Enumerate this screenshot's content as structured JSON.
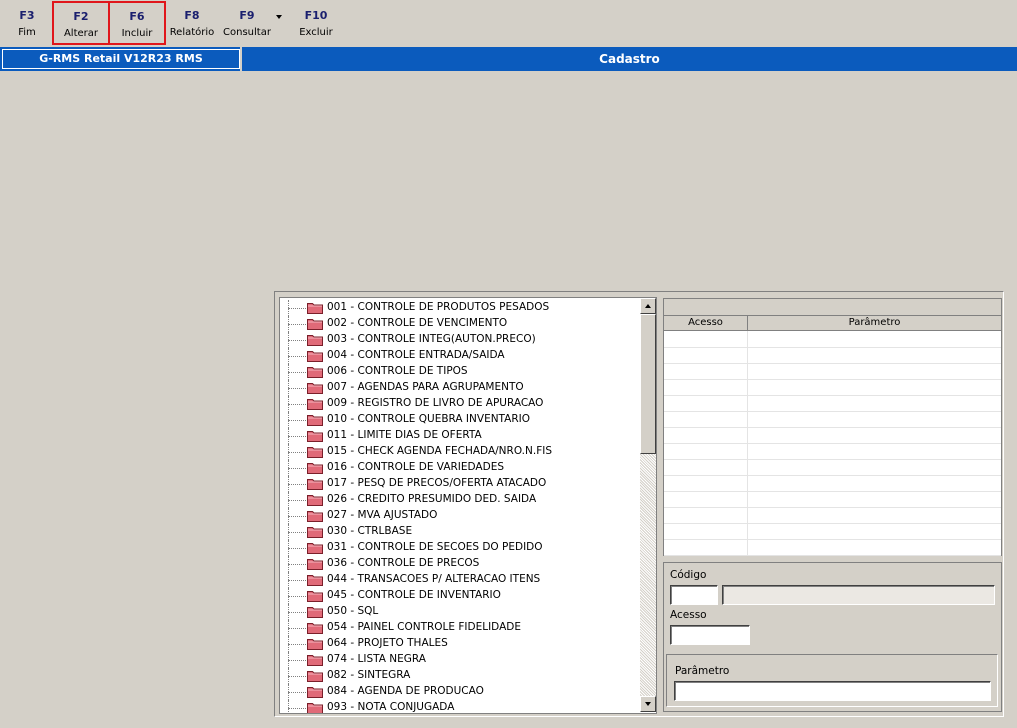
{
  "toolbar": {
    "buttons": [
      {
        "key": "F3",
        "label": "Fim"
      },
      {
        "key": "F2",
        "label": "Alterar"
      },
      {
        "key": "F6",
        "label": "Incluir"
      },
      {
        "key": "F8",
        "label": "Relatório"
      },
      {
        "key": "F9",
        "label": "Consultar"
      },
      {
        "key": "F10",
        "label": "Excluir"
      }
    ]
  },
  "titlebar": {
    "app": "G-RMS Retail V12R23 RMS",
    "section": "Cadastro"
  },
  "tree": {
    "items": [
      "001 - CONTROLE DE PRODUTOS PESADOS",
      "002 - CONTROLE DE VENCIMENTO",
      "003 - CONTROLE INTEG(AUTON.PRECO)",
      "004 - CONTROLE ENTRADA/SAIDA",
      "006 - CONTROLE DE TIPOS",
      "007 - AGENDAS PARA AGRUPAMENTO",
      "009 - REGISTRO DE LIVRO DE APURACAO",
      "010 - CONTROLE QUEBRA INVENTARIO",
      "011 - LIMITE DIAS DE OFERTA",
      "015 - CHECK AGENDA FECHADA/NRO.N.FIS",
      "016 - CONTROLE DE VARIEDADES",
      "017 - PESQ DE PRECOS/OFERTA ATACADO",
      "026 - CREDITO PRESUMIDO DED. SAIDA",
      "027 - MVA AJUSTADO",
      "030 - CTRLBASE",
      "031 - CONTROLE DE SECOES DO PEDIDO",
      "036 - CONTROLE DE PRECOS",
      "044 - TRANSACOES P/ ALTERACAO ITENS",
      "045 - CONTROLE DE INVENTARIO",
      "050 - SQL",
      "054 - PAINEL CONTROLE FIDELIDADE",
      "064 - PROJETO THALES",
      "074 - LISTA NEGRA",
      "082 - SINTEGRA",
      "084 - AGENDA DE PRODUCAO",
      "093 - NOTA CONJUGADA"
    ]
  },
  "grid": {
    "columns": [
      "Acesso",
      "Parâmetro"
    ]
  },
  "form": {
    "codigo_label": "Código",
    "codigo_value": "",
    "codigo_desc": "",
    "acesso_label": "Acesso",
    "acesso_value": "",
    "parametro_label": "Parâmetro",
    "parametro_value": ""
  },
  "colors": {
    "titlebar": "#0b5bbd",
    "highlight": "#e0161b",
    "folder": "#e06a78"
  },
  "icons": {
    "tree_item": "folder-icon",
    "dropdown": "chevron-down-icon"
  }
}
